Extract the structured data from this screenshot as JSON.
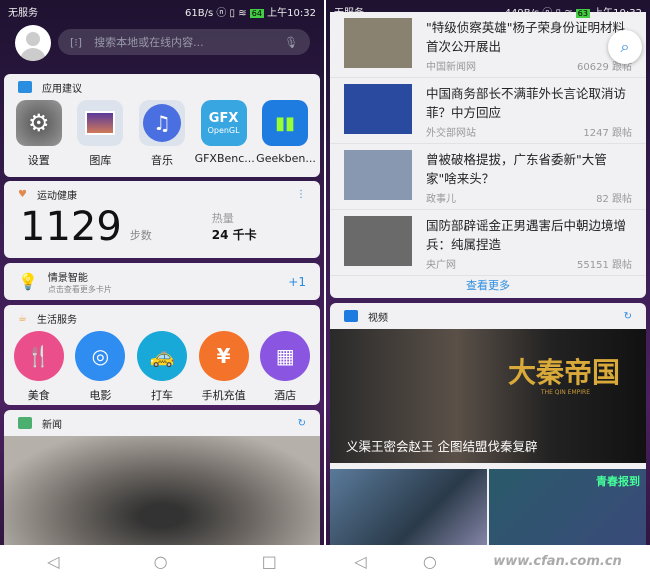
{
  "left": {
    "status": {
      "carrier": "无服务",
      "speed": "61B/s",
      "battery": "64",
      "time": "上午10:32"
    },
    "search": {
      "placeholder": "搜索本地或在线内容..."
    },
    "apps_card": {
      "title": "应用建议",
      "apps": [
        {
          "label": "设置",
          "icon": "settings-icon"
        },
        {
          "label": "图库",
          "icon": "gallery-icon"
        },
        {
          "label": "音乐",
          "icon": "music-icon"
        },
        {
          "label": "GFXBenc...",
          "icon": "gfx-icon",
          "icon_text": "GFX"
        },
        {
          "label": "Geekben...",
          "icon": "geekbench-icon"
        }
      ]
    },
    "health": {
      "title": "运动健康",
      "steps": "1129",
      "steps_unit": "步数",
      "calorie_label": "热量",
      "calorie_value": "24 千卡"
    },
    "smart": {
      "title": "情景智能",
      "subtitle": "点击查看更多卡片",
      "badge": "+1"
    },
    "life": {
      "title": "生活服务",
      "items": [
        {
          "label": "美食",
          "color": "#ea4f8c",
          "glyph": "🍴"
        },
        {
          "label": "电影",
          "color": "#2f8cf0",
          "glyph": "◎"
        },
        {
          "label": "打车",
          "color": "#19a9d8",
          "glyph": "🚕"
        },
        {
          "label": "手机充值",
          "color": "#f4732a",
          "glyph": "¥"
        },
        {
          "label": "酒店",
          "color": "#8a55e0",
          "glyph": "▦"
        }
      ]
    },
    "news": {
      "title": "新闻"
    }
  },
  "right": {
    "status": {
      "carrier": "无服务",
      "speed": "449B/s",
      "battery": "63",
      "time": "上午10:32"
    },
    "news": [
      {
        "title": "\"特级侦察英雄\"杨子荣身份证明材料首次公开展出",
        "source": "中国新闻网",
        "count": "60629",
        "suffix": "跟帖"
      },
      {
        "title": "中国商务部长不满菲外长言论取消访菲？中方回应",
        "source": "外交部网站",
        "count": "1247",
        "suffix": "跟帖"
      },
      {
        "title": "曾被破格提拔，广东省委新\"大管家\"啥来头？",
        "source": "政事儿",
        "count": "82",
        "suffix": "跟帖"
      },
      {
        "title": "国防部辟谣金正男遇害后中朝边境增兵：纯属捏造",
        "source": "央广网",
        "count": "55151",
        "suffix": "跟帖"
      }
    ],
    "more": "查看更多",
    "video": {
      "title": "视频",
      "caption": "义渠王密会赵王 企图结盟伐秦复辟",
      "poster_title": "大秦帝国",
      "poster_sub": "THE QIN EMPIRE",
      "poster2_text": "青春报到"
    },
    "watermark": "www.cfan.com.cn"
  }
}
